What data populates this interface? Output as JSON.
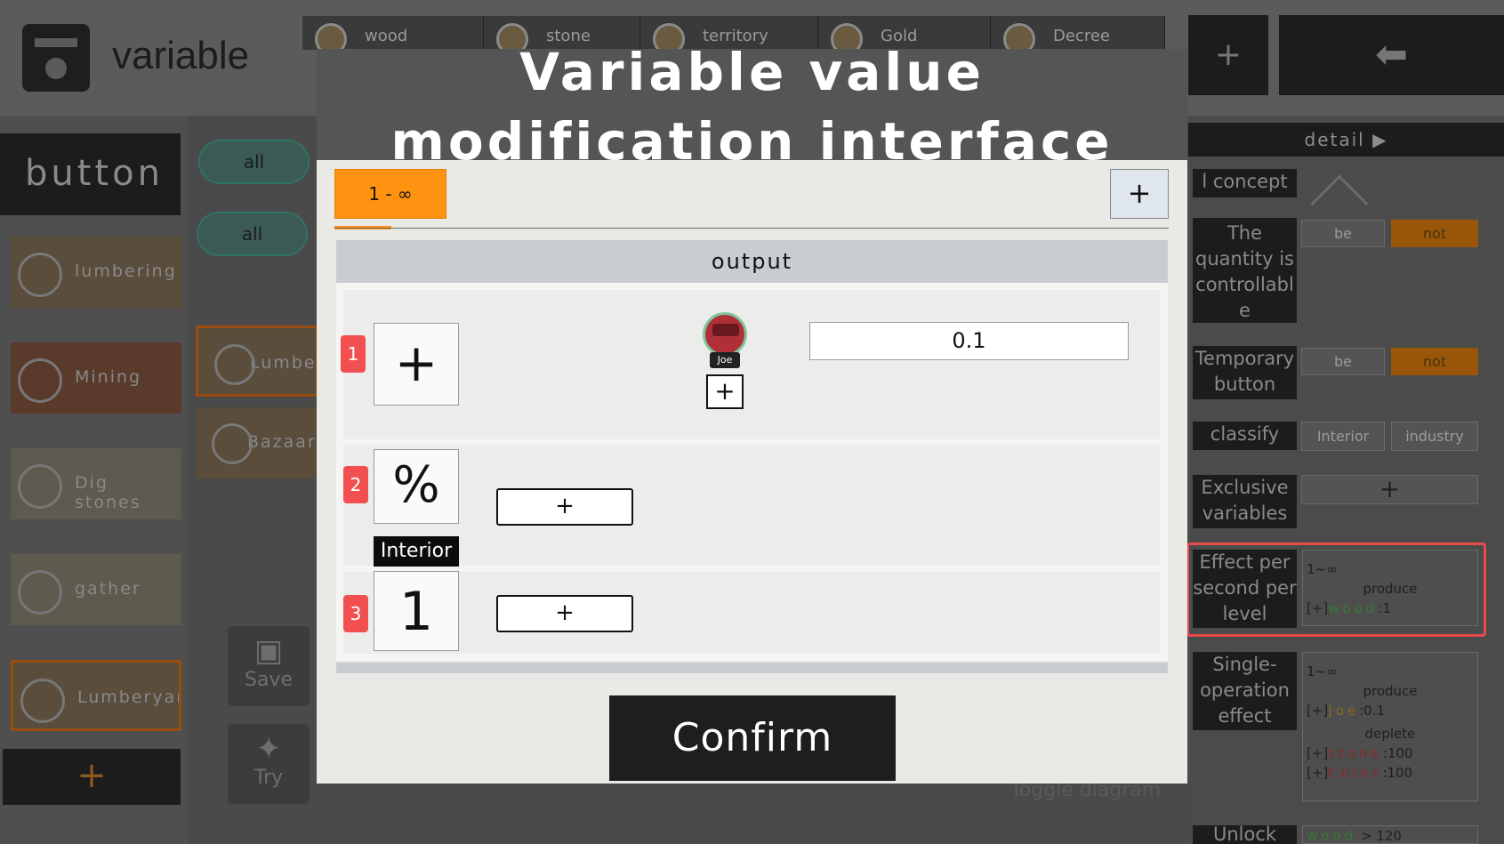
{
  "app": {
    "title": "variable",
    "resource_tabs": [
      "wood",
      "stone",
      "territory",
      "Gold",
      "Decree"
    ],
    "top_plus": "+",
    "exit_icon": "exit-icon"
  },
  "left_panel": {
    "header": "button",
    "items": [
      "lumbering",
      "Mining",
      "Dig stones",
      "gather",
      "Lumberyard"
    ],
    "add_label": "+"
  },
  "middle_panel": {
    "filters": [
      "all",
      "all"
    ],
    "items": [
      "Lumber",
      "Bazaar"
    ],
    "save_label": "Save",
    "try_label": "Try",
    "toggle_label": "Toggle diagram"
  },
  "right_panel": {
    "detail_label": "detail",
    "concept_label": "l concept",
    "controllable_label": "The quantity is controllabl e",
    "controllable_options": [
      "be",
      "not"
    ],
    "temporary_label": "Temporary button",
    "temporary_options": [
      "be",
      "not"
    ],
    "classify_label": "classify",
    "classify_options": [
      "Interior",
      "industry"
    ],
    "exclusive_label": "Exclusive variables",
    "exclusive_plus": "+",
    "effect_label": "Effect per second per level",
    "effect_range": "1~∞",
    "effect_action": "produce",
    "effect_prefix": "[+]",
    "effect_item": "wood",
    "effect_value": ":1",
    "single_label": "Single-operation effect",
    "single_range": "1~∞",
    "single_produce": "produce",
    "single_prefix": "[+]",
    "single_item": "Joe",
    "single_value": ":0.1",
    "single_deplete": "deplete",
    "deplete_1_item": "stone",
    "deplete_1_value": ":100",
    "deplete_2_item": "Coins",
    "deplete_2_value": ":100",
    "unlock_label": "Unlock",
    "unlock_item": "wood",
    "unlock_value": "> 120"
  },
  "modal": {
    "title": "Variable value modification interface",
    "range_tab": "1 - ∞",
    "add_plus": "+",
    "output_label": "output",
    "rows": [
      {
        "num": "1",
        "symbol": "+"
      },
      {
        "num": "2",
        "symbol": "%",
        "tag": "Interior",
        "plus": "+"
      },
      {
        "num": "3",
        "symbol": "1",
        "plus": "+"
      }
    ],
    "avatar_name": "Joe",
    "avatar_plus": "+",
    "value": "0.1",
    "confirm": "Confirm"
  },
  "colors": {
    "accent_orange": "#ff9210",
    "row_badge_red": "#f25050",
    "highlight_frame": "#e84a4a"
  }
}
